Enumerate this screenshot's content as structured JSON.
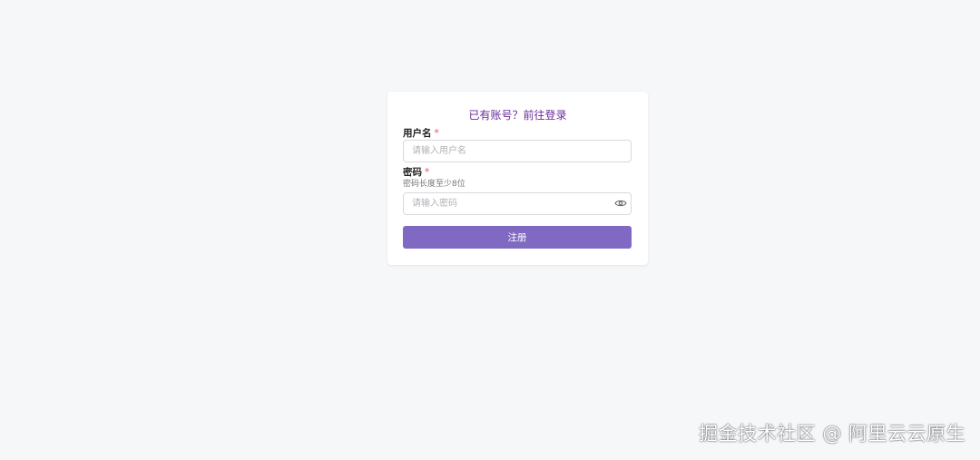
{
  "form": {
    "login_link": "已有账号？前往登录",
    "username": {
      "label": "用户名",
      "required_mark": "*",
      "placeholder": "请输入用户名",
      "value": ""
    },
    "password": {
      "label": "密码",
      "required_mark": "*",
      "hint": "密码长度至少8位",
      "placeholder": "请输入密码",
      "value": "",
      "toggle_icon": "eye-icon"
    },
    "submit_label": "注册"
  },
  "colors": {
    "accent": "#7f69c2",
    "link": "#6a2a9a",
    "required": "#e05555",
    "background": "#f6f7f9"
  },
  "watermark": "掘金技术社区 @ 阿里云云原生"
}
